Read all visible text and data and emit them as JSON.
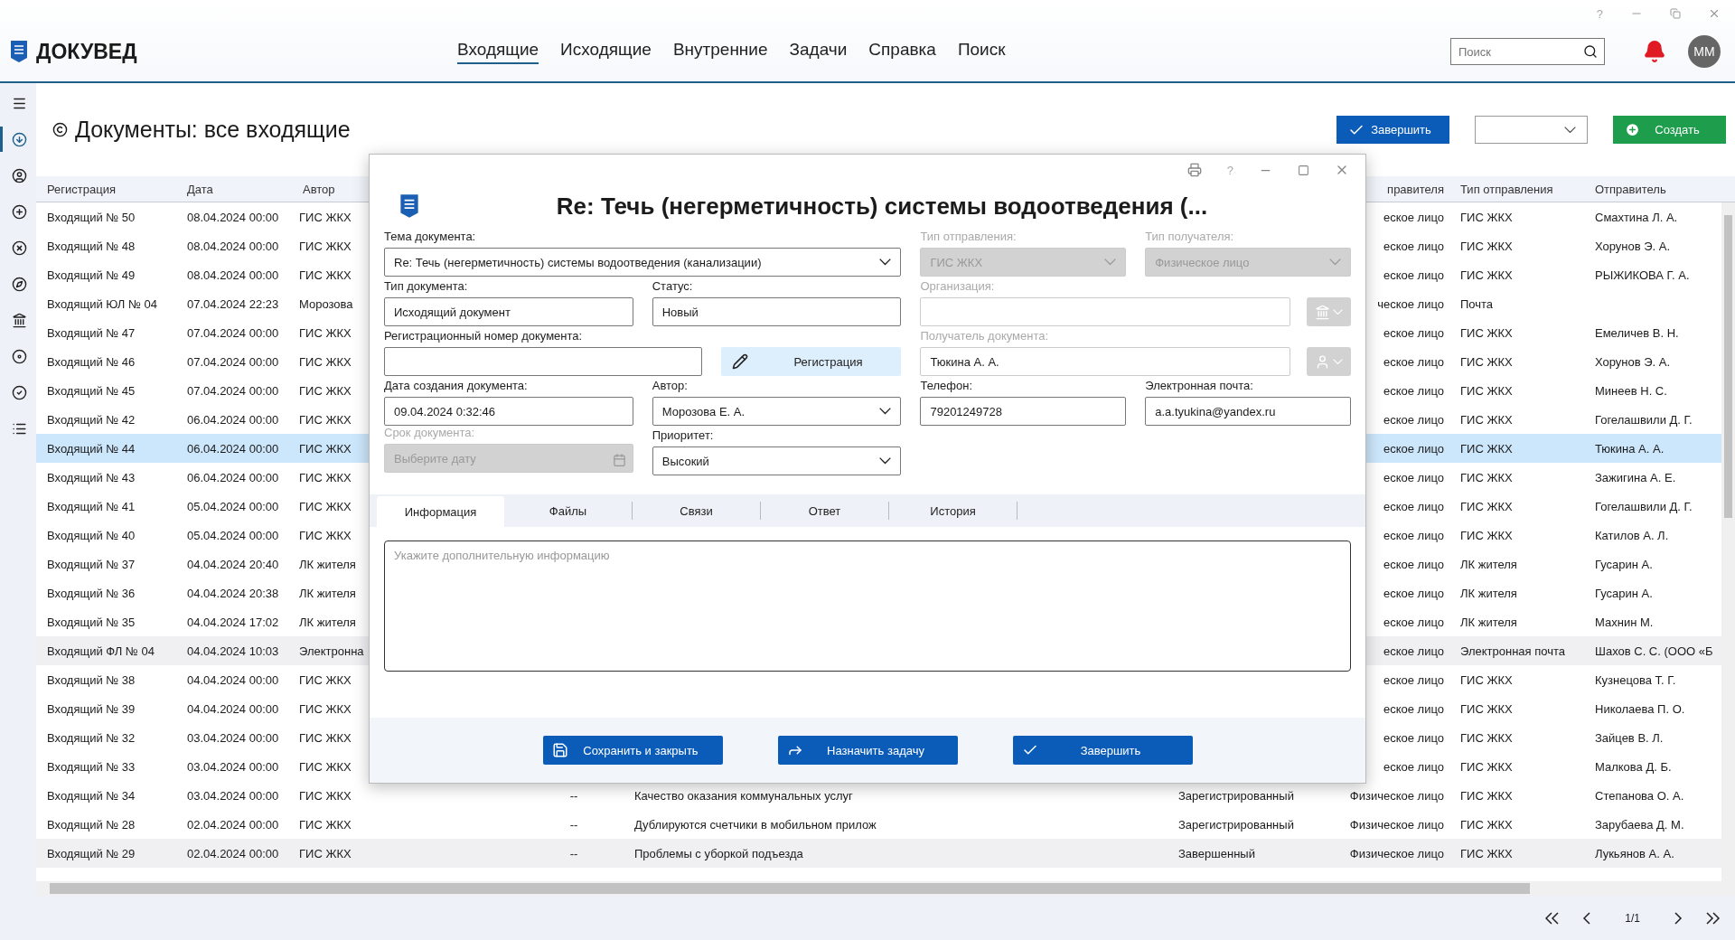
{
  "window": {
    "help": "?"
  },
  "header": {
    "logo": "ДОКУВЕД",
    "search": {
      "placeholder": "Поиск"
    },
    "avatar": "ММ",
    "nav": [
      {
        "label": "Входящие",
        "selected": true
      },
      {
        "label": "Исходящие",
        "selected": false
      },
      {
        "label": "Внутренние",
        "selected": false
      },
      {
        "label": "Задачи",
        "selected": false
      },
      {
        "label": "Справка",
        "selected": false
      },
      {
        "label": "Поиск",
        "selected": false
      }
    ]
  },
  "sidebar": {
    "items": [
      {
        "kind": "menu",
        "selected": false
      },
      {
        "kind": "incoming",
        "selected": true
      },
      {
        "kind": "user",
        "selected": false
      },
      {
        "kind": "add",
        "selected": false
      },
      {
        "kind": "cancel",
        "selected": false
      },
      {
        "kind": "compass",
        "selected": false
      },
      {
        "kind": "bank",
        "selected": false
      },
      {
        "kind": "disc",
        "selected": false
      },
      {
        "kind": "done",
        "selected": false
      },
      {
        "kind": "list",
        "selected": false
      }
    ]
  },
  "page": {
    "title": "Документы: все входящие",
    "actions": [
      {
        "kind": "finish",
        "label": "Завершить"
      },
      {
        "kind": "select"
      },
      {
        "kind": "create",
        "label": "Создать"
      }
    ]
  },
  "table": {
    "columns": {
      "registration": "Регистрация",
      "date": "Дата",
      "author": "Автор",
      "recipient_type": "правителя",
      "send_type": "Тип отправления",
      "sender": "Отправитель"
    },
    "rows": [
      {
        "registration": "Входящий № 50",
        "date": "08.04.2024 00:00",
        "author": "ГИС ЖКХ",
        "recipient_type": "еское лицо",
        "send_type": "ГИС ЖКХ",
        "sender": "Смахтина Л. А.",
        "selected": false,
        "marked": false
      },
      {
        "registration": "Входящий № 48",
        "date": "08.04.2024 00:00",
        "author": "ГИС ЖКХ",
        "recipient_type": "еское лицо",
        "send_type": "ГИС ЖКХ",
        "sender": "Хорунов Э. А.",
        "selected": false,
        "marked": false
      },
      {
        "registration": "Входящий № 49",
        "date": "08.04.2024 00:00",
        "author": "ГИС ЖКХ",
        "recipient_type": "еское лицо",
        "send_type": "ГИС ЖКХ",
        "sender": "РЫЖИКОВА Г. А.",
        "selected": false,
        "marked": false
      },
      {
        "registration": "Входящий ЮЛ № 04",
        "date": "07.04.2024 22:23",
        "author": "Морозова",
        "recipient_type": "ческое лицо",
        "send_type": "Почта",
        "selected": false,
        "marked": false
      },
      {
        "registration": "Входящий № 47",
        "date": "07.04.2024 00:00",
        "author": "ГИС ЖКХ",
        "recipient_type": "еское лицо",
        "send_type": "ГИС ЖКХ",
        "sender": "Емеличев В. Н.",
        "selected": false,
        "marked": false
      },
      {
        "registration": "Входящий № 46",
        "date": "07.04.2024 00:00",
        "author": "ГИС ЖКХ",
        "recipient_type": "еское лицо",
        "send_type": "ГИС ЖКХ",
        "sender": "Хорунов Э. А.",
        "selected": false,
        "marked": false
      },
      {
        "registration": "Входящий № 45",
        "date": "07.04.2024 00:00",
        "author": "ГИС ЖКХ",
        "recipient_type": "еское лицо",
        "send_type": "ГИС ЖКХ",
        "sender": "Минеев Н. С.",
        "selected": false,
        "marked": false
      },
      {
        "registration": "Входящий № 42",
        "date": "06.04.2024 00:00",
        "author": "ГИС ЖКХ",
        "recipient_type": "еское лицо",
        "send_type": "ГИС ЖКХ",
        "sender": "Гогелашвили Д. Г.",
        "selected": false,
        "marked": false
      },
      {
        "registration": "Входящий № 44",
        "date": "06.04.2024 00:00",
        "author": "ГИС ЖКХ",
        "recipient_type": "еское лицо",
        "send_type": "ГИС ЖКХ",
        "sender": "Тюкина А. А.",
        "selected": true,
        "marked": false
      },
      {
        "registration": "Входящий № 43",
        "date": "06.04.2024 00:00",
        "author": "ГИС ЖКХ",
        "recipient_type": "еское лицо",
        "send_type": "ГИС ЖКХ",
        "sender": "Зажигина А. Е.",
        "selected": false,
        "marked": false
      },
      {
        "registration": "Входящий № 41",
        "date": "05.04.2024 00:00",
        "author": "ГИС ЖКХ",
        "recipient_type": "еское лицо",
        "send_type": "ГИС ЖКХ",
        "sender": "Гогелашвили Д. Г.",
        "selected": false,
        "marked": false
      },
      {
        "registration": "Входящий № 40",
        "date": "05.04.2024 00:00",
        "author": "ГИС ЖКХ",
        "recipient_type": "еское лицо",
        "send_type": "ГИС ЖКХ",
        "sender": "Катилов А. Л.",
        "selected": false,
        "marked": false
      },
      {
        "registration": "Входящий № 37",
        "date": "04.04.2024 20:40",
        "author": "ЛК жителя",
        "recipient_type": "еское лицо",
        "send_type": "ЛК жителя",
        "sender": "Гусарин А.",
        "selected": false,
        "marked": false
      },
      {
        "registration": "Входящий № 36",
        "date": "04.04.2024 20:38",
        "author": "ЛК жителя",
        "recipient_type": "еское лицо",
        "send_type": "ЛК жителя",
        "sender": "Гусарин А.",
        "selected": false,
        "marked": false
      },
      {
        "registration": "Входящий № 35",
        "date": "04.04.2024 17:02",
        "author": "ЛК жителя",
        "recipient_type": "еское лицо",
        "send_type": "ЛК жителя",
        "sender": "Махнин М.",
        "selected": false,
        "marked": false
      },
      {
        "registration": "Входящий ФЛ № 04",
        "date": "04.04.2024 10:03",
        "author": "Электронна",
        "recipient_type": "еское лицо",
        "send_type": "Электронная почта",
        "sender": "Шахов С. С. (ООО «Б",
        "selected": false,
        "marked": true
      },
      {
        "registration": "Входящий № 38",
        "date": "04.04.2024 00:00",
        "author": "ГИС ЖКХ",
        "recipient_type": "еское лицо",
        "send_type": "ГИС ЖКХ",
        "sender": "Кузнецова Т. Г.",
        "selected": false,
        "marked": false
      },
      {
        "registration": "Входящий № 39",
        "date": "04.04.2024 00:00",
        "author": "ГИС ЖКХ",
        "recipient_type": "еское лицо",
        "send_type": "ГИС ЖКХ",
        "sender": "Николаева П. О.",
        "selected": false,
        "marked": false
      },
      {
        "registration": "Входящий № 32",
        "date": "03.04.2024 00:00",
        "author": "ГИС ЖКХ",
        "recipient_type": "еское лицо",
        "send_type": "ГИС ЖКХ",
        "sender": "Зайцев В. Л.",
        "selected": false,
        "marked": false
      },
      {
        "registration": "Входящий № 33",
        "date": "03.04.2024 00:00",
        "author": "ГИС ЖКХ",
        "recipient_type": "еское лицо",
        "send_type": "ГИС ЖКХ",
        "sender": "Малкова Д. Б.",
        "selected": false,
        "marked": false
      },
      {
        "registration": "Входящий № 34",
        "date": "03.04.2024 00:00",
        "author": "ГИС ЖКХ",
        "number": "--",
        "subject": "Качество оказания коммунальных услуг",
        "status": "Зарегистрированный",
        "recipient_type": "Физическое лицо",
        "send_type": "ГИС ЖКХ",
        "sender": "Степанова О. А.",
        "selected": false,
        "marked": false
      },
      {
        "registration": "Входящий № 28",
        "date": "02.04.2024 00:00",
        "author": "ГИС ЖКХ",
        "number": "--",
        "subject": "Дублируются счетчики в мобильном прилож",
        "status": "Зарегистрированный",
        "recipient_type": "Физическое лицо",
        "send_type": "ГИС ЖКХ",
        "sender": "Зарубаева Д. М.",
        "selected": false,
        "marked": false
      },
      {
        "registration": "Входящий № 29",
        "date": "02.04.2024 00:00",
        "author": "ГИС ЖКХ",
        "number": "--",
        "subject": "Проблемы с уборкой подъезда",
        "status": "Завершенный",
        "recipient_type": "Физическое лицо",
        "send_type": "ГИС ЖКХ",
        "sender": "Лукьянов А. А.",
        "selected": false,
        "marked": true
      }
    ]
  },
  "pager": {
    "page": "1/1"
  },
  "dialog": {
    "help": "?",
    "title": "Re: Течь (негерметичность) системы водоотведения (...",
    "left_rows": [
      [
        {
          "kind": "combo",
          "label": "Тема документа:",
          "value": "Re: Течь (негерметичность) системы водоотведения (канализации)",
          "disabled": false
        }
      ],
      [
        {
          "kind": "text",
          "label": "Тип документа:",
          "value": "Исходящий документ",
          "disabled": false
        },
        {
          "kind": "text",
          "label": "Статус:",
          "value": "Новый",
          "disabled": false
        }
      ],
      [
        {
          "kind": "text",
          "label": "Регистрационный номер документа:",
          "disabled": false
        },
        {
          "kind": "button",
          "text": "Регистрация"
        }
      ],
      [
        {
          "kind": "text",
          "label": "Дата создания документа:",
          "value": "09.04.2024 0:32:46",
          "disabled": false
        },
        {
          "kind": "combo",
          "label": "Автор:",
          "value": "Морозова Е. А.",
          "disabled": false
        }
      ],
      [
        {
          "kind": "date",
          "label": "Срок документа:",
          "placeholder": "Выберите дату",
          "disabled": true
        },
        {
          "kind": "combo",
          "label": "Приоритет:",
          "value": "Высокий",
          "disabled": false
        }
      ]
    ],
    "right_rows": [
      [
        {
          "kind": "combo",
          "label": "Тип отправления:",
          "value": "ГИС ЖКХ",
          "disabled": true
        },
        {
          "kind": "combo",
          "label": "Тип получателя:",
          "value": "Физическое лицо",
          "disabled": true
        }
      ],
      [
        {
          "kind": "org_picker",
          "label": "Организация:",
          "disabled": true
        }
      ],
      [
        {
          "kind": "person_picker",
          "label": "Получатель документа:",
          "value": "Тюкина А. А.",
          "disabled": true
        }
      ],
      [
        {
          "kind": "text",
          "label": "Телефон:",
          "value": "79201249728",
          "disabled": false
        },
        {
          "kind": "text",
          "label": "Электронная почта:",
          "value": "a.a.tyukina@yandex.ru",
          "disabled": false
        }
      ]
    ],
    "tabs": [
      {
        "label": "Информация",
        "selected": true
      },
      {
        "label": "Файлы",
        "selected": false
      },
      {
        "label": "Связи",
        "selected": false
      },
      {
        "label": "Ответ",
        "selected": false
      },
      {
        "label": "История",
        "selected": false
      }
    ],
    "notes": {
      "placeholder": "Укажите дополнительную информацию"
    },
    "buttons": [
      {
        "kind": "save",
        "label": "Сохранить и закрыть"
      },
      {
        "kind": "assign",
        "label": "Назначить задачу"
      },
      {
        "kind": "finish",
        "label": "Завершить"
      }
    ]
  }
}
